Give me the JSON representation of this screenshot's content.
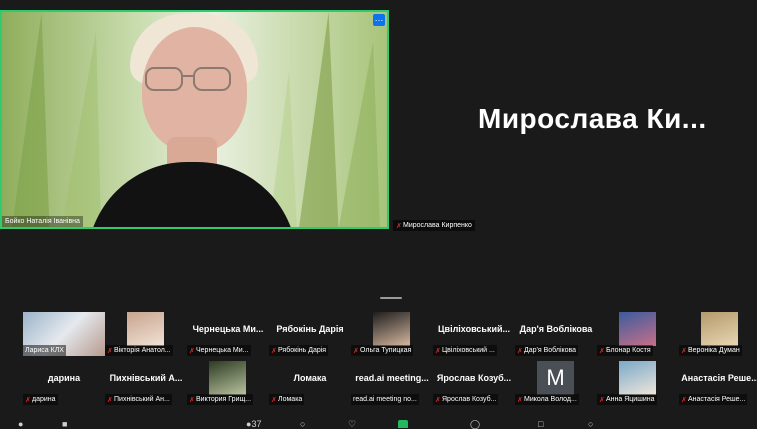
{
  "meeting": {
    "active_speaker": {
      "name": "Бойко Наталія Іванівна",
      "menu_icon": "ellipsis-icon",
      "menu_glyph": "…"
    },
    "pinned_participant": {
      "display_name": "Мирослава Ки...",
      "tag": "Мирослава Кирпенко"
    },
    "accent_color": "#2ecc71",
    "mute_color": "#e02828"
  },
  "gallery": [
    {
      "label": "Лариса КЛХ",
      "muted": false,
      "kind": "video"
    },
    {
      "label": "Вікторія Анатол...",
      "muted": true,
      "kind": "photo"
    },
    {
      "label": "Чернецька Ми...",
      "muted": true,
      "kind": "name",
      "title": "Чернецька Ми..."
    },
    {
      "label": "Рябокінь Дарія",
      "muted": true,
      "kind": "name",
      "title": "Рябокінь Дарія"
    },
    {
      "label": "Ольга Тупицкая",
      "muted": true,
      "kind": "photo"
    },
    {
      "label": "Цвіліховський ...",
      "muted": true,
      "kind": "name",
      "title": "Цвіліховський..."
    },
    {
      "label": "Дар'я Воблікова",
      "muted": true,
      "kind": "name",
      "title": "Дар'я Воблікова"
    },
    {
      "label": "Блонар Костя",
      "muted": true,
      "kind": "photo"
    },
    {
      "label": "Вероніка Думан",
      "muted": true,
      "kind": "photo"
    },
    {
      "label": "дарина",
      "muted": true,
      "kind": "name",
      "title": "дарина"
    },
    {
      "label": "Пихнівський Ан...",
      "muted": true,
      "kind": "name",
      "title": "Пихнівський А..."
    },
    {
      "label": "Виктория Грищ...",
      "muted": true,
      "kind": "photo"
    },
    {
      "label": "Ломака",
      "muted": true,
      "kind": "name",
      "title": "Ломака"
    },
    {
      "label": "read.ai meeting no...",
      "muted": false,
      "kind": "name",
      "title": "read.ai meeting..."
    },
    {
      "label": "Ярослав Козуб...",
      "muted": true,
      "kind": "name",
      "title": "Ярослав Козуб..."
    },
    {
      "label": "Микола Волод...",
      "muted": true,
      "kind": "letter",
      "letter": "M"
    },
    {
      "label": "Анна Яцишина",
      "muted": true,
      "kind": "photo"
    },
    {
      "label": "Анастасія Реше...",
      "muted": true,
      "kind": "name",
      "title": "Анастасія Реше..."
    }
  ],
  "toolbar": {
    "participants_count": "37",
    "icons": [
      "microphone-icon",
      "camera-icon",
      "participants-icon",
      "chat-icon",
      "react-icon",
      "share-screen-icon",
      "record-icon",
      "apps-icon",
      "more-icon"
    ]
  }
}
